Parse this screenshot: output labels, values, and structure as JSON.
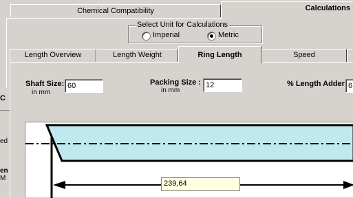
{
  "outer_tabs": [
    {
      "label": "Chemical Compatibility"
    },
    {
      "label": "Calculations"
    }
  ],
  "units": {
    "legend": "Select Unit for Calculations",
    "imperial_label": "Imperial",
    "metric_label": "Metric",
    "selected": "Metric"
  },
  "inner_tabs": [
    {
      "label": "Length Overview"
    },
    {
      "label": "Length Weight"
    },
    {
      "label": "Ring Length"
    },
    {
      "label": "Speed"
    }
  ],
  "fields": {
    "shaft_label": "Shaft Size:",
    "shaft_sub": "in mm",
    "shaft_value": "60",
    "packing_label": "Packing Size :",
    "packing_sub": "in mm",
    "packing_value": "12",
    "adder_label": "% Length Adder :",
    "adder_value": "6"
  },
  "result_value": "239,64",
  "left_fragment": {
    "c": "C",
    "ed": "ed",
    "en": "en",
    "m": "M"
  },
  "colors": {
    "ring_fill": "#bfe9ee",
    "result_bg": "#ffffe1"
  }
}
